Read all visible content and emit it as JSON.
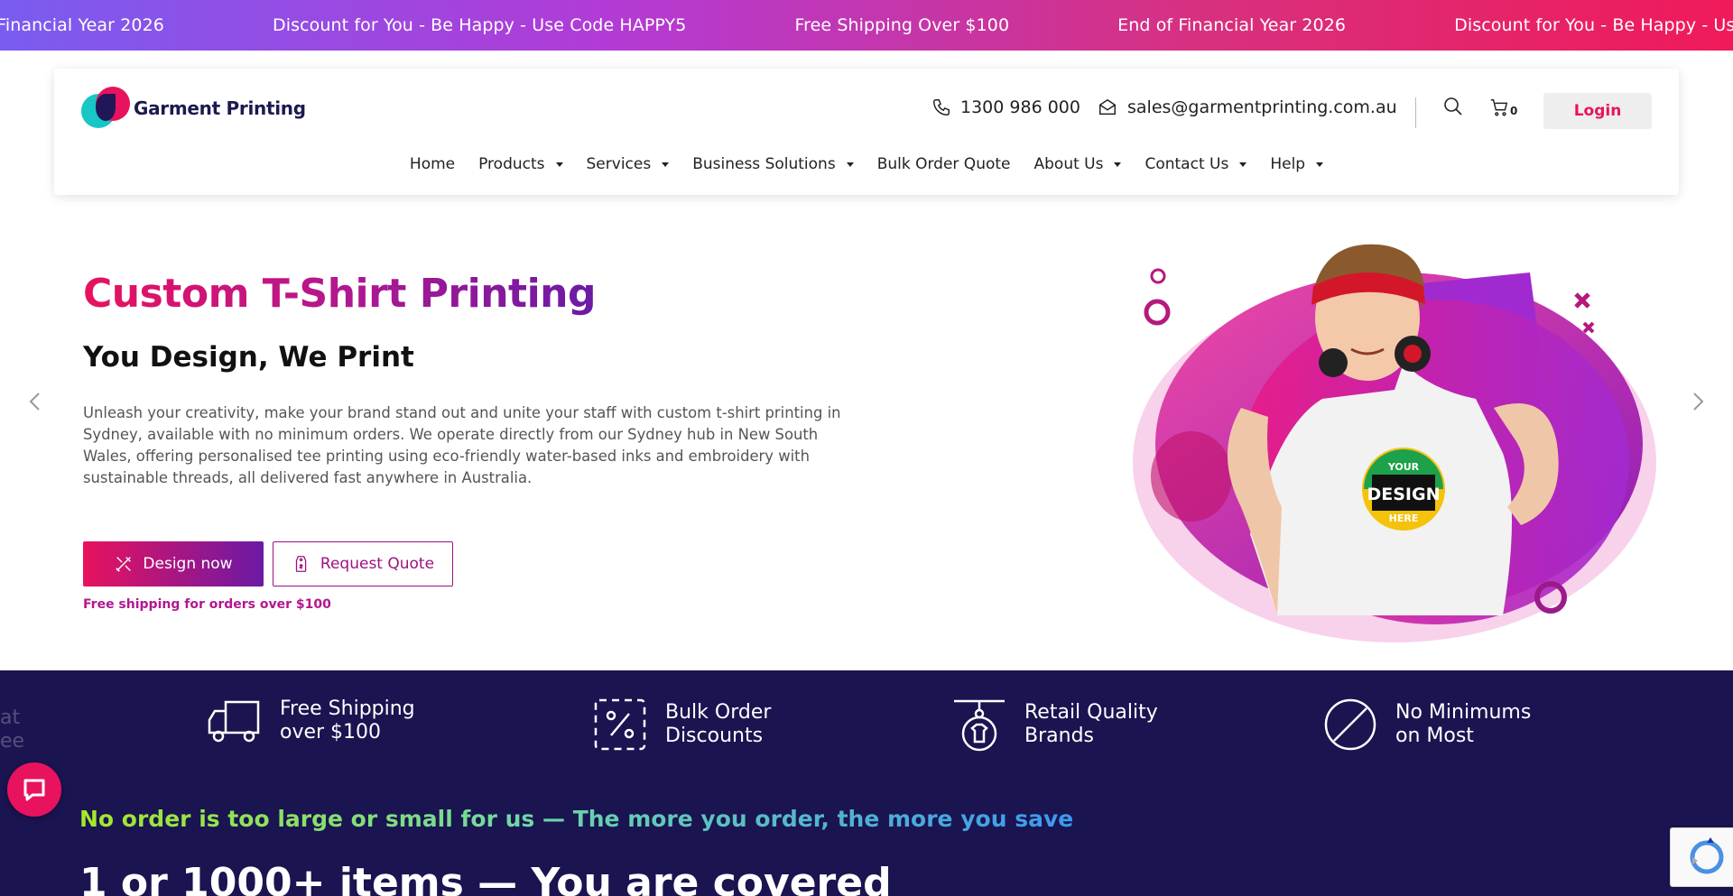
{
  "ticker": {
    "items": [
      "End of Financial Year 2026",
      "Discount for You - Be Happy - Use Code HAPPY5",
      "Free Shipping Over $100",
      "End of Financial Year 2026",
      "Discount for You - Be Happy - Use Code HAPPY5"
    ],
    "gradient": [
      "#7a5cf0",
      "#f01a5a"
    ]
  },
  "header": {
    "logo_text": "Garment Printing",
    "phone": "1300 986 000",
    "email": "sales@garmentprinting.com.au",
    "cart_count": "0",
    "login_label": "Login"
  },
  "nav": {
    "items": [
      {
        "label": "Home",
        "dropdown": false
      },
      {
        "label": "Products",
        "dropdown": true
      },
      {
        "label": "Services",
        "dropdown": true
      },
      {
        "label": "Business Solutions",
        "dropdown": true
      },
      {
        "label": "Bulk Order Quote",
        "dropdown": false
      },
      {
        "label": "About Us",
        "dropdown": true
      },
      {
        "label": "Contact Us",
        "dropdown": true
      },
      {
        "label": "Help",
        "dropdown": true
      }
    ]
  },
  "hero": {
    "title": "Custom T-Shirt Printing",
    "subtitle": "You Design, We Print",
    "description": "Unleash your creativity, make your brand stand out and unite your staff with custom t-shirt printing in Sydney, available with no minimum orders. We operate directly from our Sydney hub in New South Wales, offering personalised tee printing using eco-friendly water-based inks and embroidery with sustainable threads, all delivered fast anywhere in Australia.",
    "design_button": "Design now",
    "quote_button": "Request Quote",
    "free_shipping_note": "Free shipping for orders over $100",
    "shirt_badge": {
      "top": "YOUR",
      "main": "DESIGN",
      "bottom": "HERE"
    }
  },
  "features": [
    {
      "line1": "Free Shipping",
      "line2": "over $100",
      "icon": "truck-icon"
    },
    {
      "line1": "Bulk Order",
      "line2": "Discounts",
      "icon": "discount-tag-icon"
    },
    {
      "line1": "Retail Quality",
      "line2": "Brands",
      "icon": "shirt-hanger-icon"
    },
    {
      "line1": "No Minimums",
      "line2": "on Most",
      "icon": "no-minimum-icon"
    }
  ],
  "edge_fragments": {
    "line1": "at",
    "line2": "ee"
  },
  "promo": {
    "tagline": "No order is too large or small for us — The more you order, the more you save",
    "headline": "1 or 1000+ items — You are covered"
  },
  "colors": {
    "brand_pink": "#e8125e",
    "brand_purple": "#6b1aa5",
    "dark_band": "#1a1450",
    "accent_teal": "#18c6c6"
  }
}
